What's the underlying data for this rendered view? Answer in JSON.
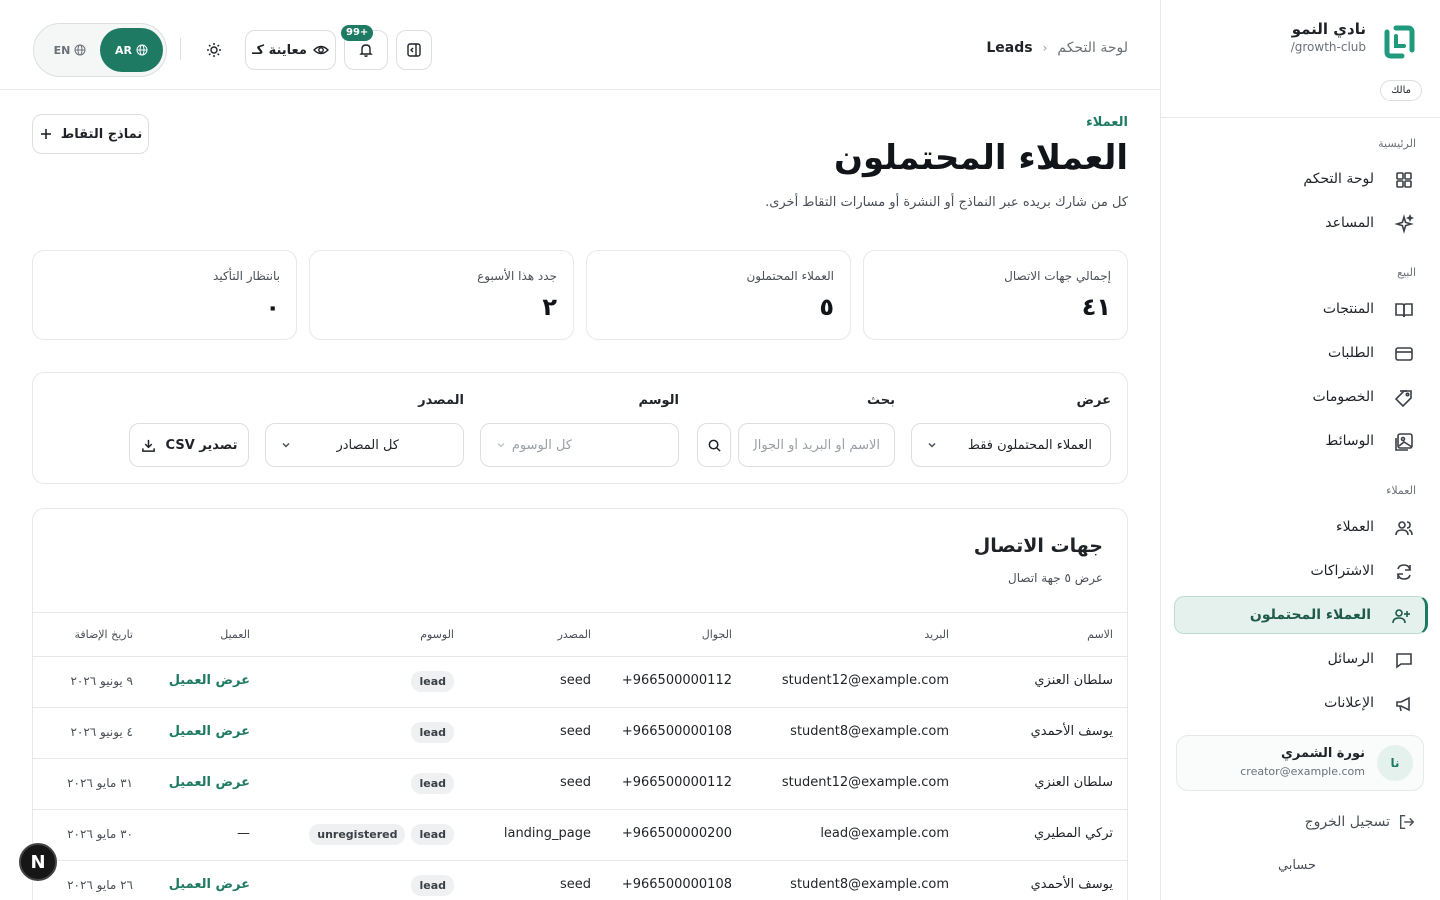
{
  "brand": {
    "name": "نادي النمو",
    "slug": "/growth-club",
    "role": "مالك"
  },
  "nav": {
    "sections": [
      {
        "label": "الرئيسية",
        "items": [
          {
            "label": "لوحة التحكم",
            "icon": "dashboard-icon"
          },
          {
            "label": "المساعد",
            "icon": "sparkles-icon"
          }
        ]
      },
      {
        "label": "البيع",
        "items": [
          {
            "label": "المنتجات",
            "icon": "book-icon"
          },
          {
            "label": "الطلبات",
            "icon": "card-icon"
          },
          {
            "label": "الخصومات",
            "icon": "tag-icon"
          },
          {
            "label": "الوسائط",
            "icon": "image-icon"
          }
        ]
      },
      {
        "label": "العملاء",
        "items": [
          {
            "label": "العملاء",
            "icon": "users-icon"
          },
          {
            "label": "الاشتراكات",
            "icon": "refresh-icon"
          },
          {
            "label": "العملاء المحتملون",
            "icon": "user-plus-icon",
            "active": true
          },
          {
            "label": "الرسائل",
            "icon": "message-icon"
          },
          {
            "label": "الإعلانات",
            "icon": "megaphone-icon"
          }
        ]
      }
    ]
  },
  "user": {
    "initials": "نا",
    "name": "نورة الشمري",
    "email": "creator@example.com"
  },
  "footer": {
    "logout": "تسجيل الخروج",
    "account": "حسابي"
  },
  "topbar": {
    "breadcrumb": {
      "parent": "لوحة التحكم",
      "current": "Leads"
    },
    "notifications_badge": "+99",
    "preview_label": "معاينة كـ",
    "lang": {
      "ar": "AR",
      "en": "EN",
      "active": "ar"
    }
  },
  "page": {
    "eyebrow": "العملاء",
    "title": "العملاء المحتملون",
    "description": "كل من شارك بريده عبر النماذج أو النشرة أو مسارات التقاط أخرى.",
    "capture_forms_button": "نماذج التقاط"
  },
  "stats": [
    {
      "label": "إجمالي جهات الاتصال",
      "value": "٤١"
    },
    {
      "label": "العملاء المحتملون",
      "value": "٥"
    },
    {
      "label": "جدد هذا الأسبوع",
      "value": "٢"
    },
    {
      "label": "بانتظار التأكيد",
      "value": "٠"
    }
  ],
  "filters": {
    "view": {
      "label": "عرض",
      "value": "العملاء المحتملون فقط"
    },
    "search": {
      "label": "بحث",
      "placeholder": "الاسم أو البريد أو الجوال",
      "value": ""
    },
    "tag": {
      "label": "الوسم",
      "placeholder": "كل الوسوم"
    },
    "source": {
      "label": "المصدر",
      "value": "كل المصادر"
    },
    "export_label": "تصدير CSV"
  },
  "table": {
    "title": "جهات الاتصال",
    "subtitle": "عرض ٥ جهة اتصال",
    "columns": [
      "الاسم",
      "البريد",
      "الجوال",
      "المصدر",
      "الوسوم",
      "العميل",
      "تاريخ الإضافة"
    ],
    "rows": [
      {
        "name": "سلطان العنزي",
        "email": "student12@example.com",
        "phone": "+966500000112",
        "source": "seed",
        "tags": [
          "lead"
        ],
        "client": "عرض العميل",
        "date": "٩ يونيو ٢٠٢٦"
      },
      {
        "name": "يوسف الأحمدي",
        "email": "student8@example.com",
        "phone": "+966500000108",
        "source": "seed",
        "tags": [
          "lead"
        ],
        "client": "عرض العميل",
        "date": "٤ يونيو ٢٠٢٦"
      },
      {
        "name": "سلطان العنزي",
        "email": "student12@example.com",
        "phone": "+966500000112",
        "source": "seed",
        "tags": [
          "lead"
        ],
        "client": "عرض العميل",
        "date": "٣١ مايو ٢٠٢٦"
      },
      {
        "name": "تركي المطيري",
        "email": "lead@example.com",
        "phone": "+966500000200",
        "source": "landing_page",
        "tags": [
          "lead",
          "unregistered"
        ],
        "client": "—",
        "date": "٣٠ مايو ٢٠٢٦"
      },
      {
        "name": "يوسف الأحمدي",
        "email": "student8@example.com",
        "phone": "+966500000108",
        "source": "seed",
        "tags": [
          "lead"
        ],
        "client": "عرض العميل",
        "date": "٢٦ مايو ٢٠٢٦"
      }
    ]
  },
  "dev_badge": "N",
  "colors": {
    "accent": "#1f7a63",
    "accent_soft": "#e4f1ec",
    "border": "#e6e8ea"
  }
}
